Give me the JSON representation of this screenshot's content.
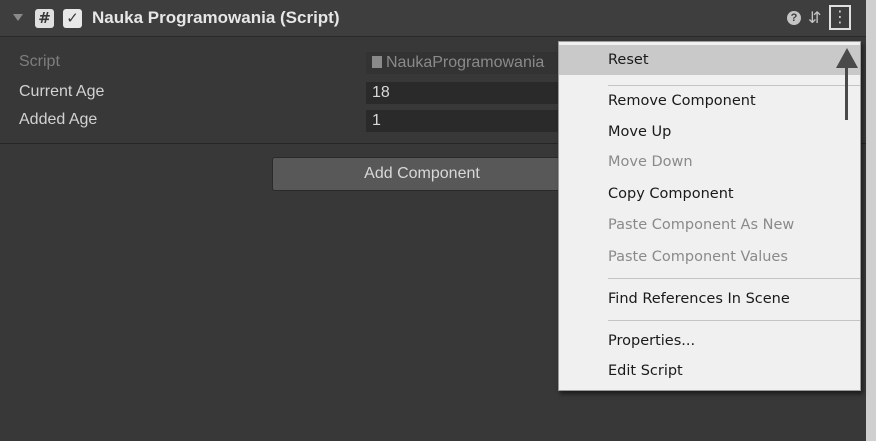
{
  "component": {
    "title": "Nauka Programowania (Script)",
    "script_icon": "#",
    "enabled_glyph": "✓",
    "help_glyph": "?",
    "preset_glyph": "⇵",
    "menu_glyph": "⋮"
  },
  "fields": [
    {
      "label": "Script",
      "value": "NaukaProgramowania"
    },
    {
      "label": "Current Age",
      "value": "18"
    },
    {
      "label": "Added Age",
      "value": "1"
    }
  ],
  "add_component_label": "Add Component",
  "context_menu": {
    "items": [
      {
        "label": "Reset",
        "enabled": true,
        "highlighted": true
      },
      {
        "label": "Remove Component",
        "enabled": true
      },
      {
        "label": "Move Up",
        "enabled": true
      },
      {
        "label": "Move Down",
        "enabled": false
      },
      {
        "label": "Copy Component",
        "enabled": true
      },
      {
        "label": "Paste Component As New",
        "enabled": false
      },
      {
        "label": "Paste Component Values",
        "enabled": false
      },
      {
        "label": "Find References In Scene",
        "enabled": true
      },
      {
        "label": "Properties...",
        "enabled": true
      },
      {
        "label": "Edit Script",
        "enabled": true
      }
    ]
  },
  "colors": {
    "inspector_bg": "#383838",
    "menu_bg": "#f0f0f0",
    "menu_highlight": "#c9c9c9",
    "annotation_arrow": "#4a4a4a"
  }
}
